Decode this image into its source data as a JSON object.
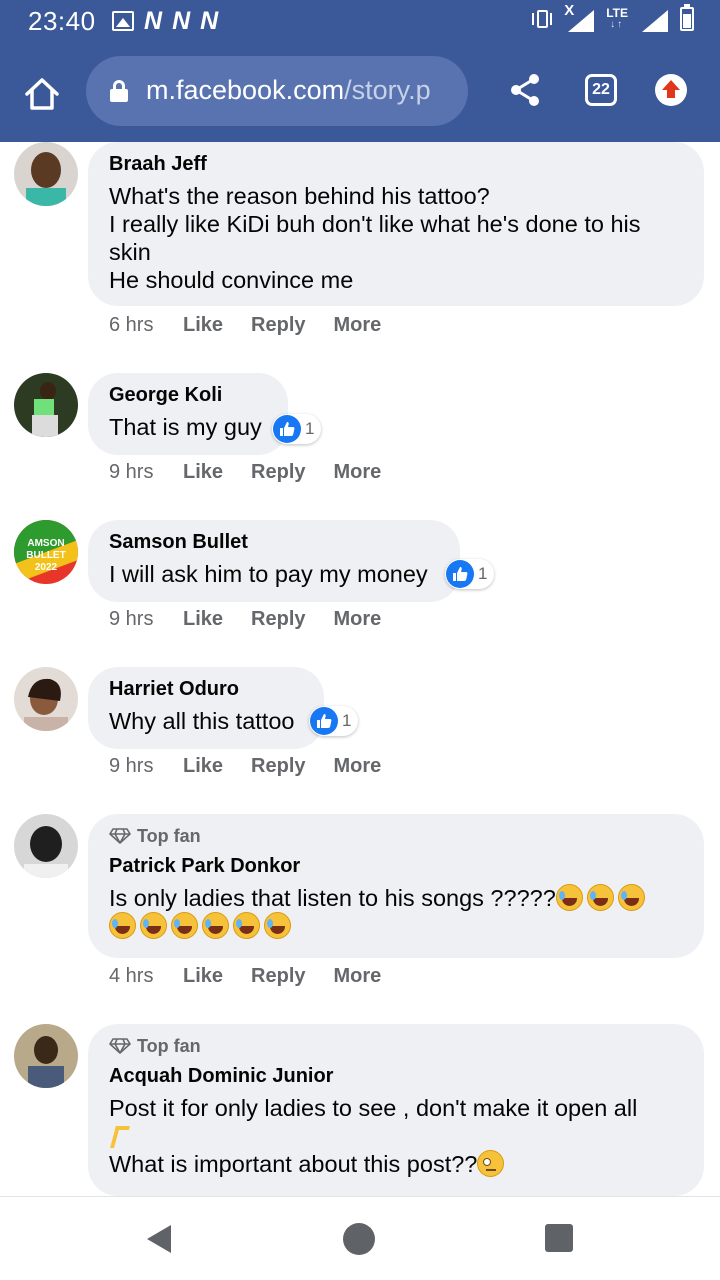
{
  "status_bar": {
    "time": "23:40",
    "notif_letters": [
      "N",
      "N",
      "N"
    ],
    "network": "LTE",
    "network_arrows": "↓↑",
    "signal_x": "X"
  },
  "browser": {
    "domain": "m.facebook.com",
    "path": "/story.p",
    "tab_count": "22"
  },
  "comments": [
    {
      "author": "Braah Jeff",
      "top_fan": false,
      "text": "What's the reason behind his tattoo?\nI really like KiDi buh don't like what he's done to his skin\nHe should convince me",
      "time": "6 hrs",
      "likes": null,
      "avatar_color": "#7d5a3c"
    },
    {
      "author": "George Koli",
      "top_fan": false,
      "text": "That is my guy",
      "time": "9 hrs",
      "likes": "1",
      "avatar_color": "#2d3b22"
    },
    {
      "author": "Samson Bullet",
      "top_fan": false,
      "text": "I will ask him to pay my money",
      "time": "9 hrs",
      "likes": "1",
      "avatar_color": "#2e8b2e",
      "avatar_text": "AMSON BULLET 2022"
    },
    {
      "author": "Harriet Oduro",
      "top_fan": false,
      "text": "Why all this tattoo",
      "time": "9 hrs",
      "likes": "1",
      "avatar_color": "#b89a8a"
    },
    {
      "author": "Patrick Park Donkor",
      "top_fan": true,
      "text": "Is only ladies that listen to his songs ?????",
      "time": "4 hrs",
      "likes": null,
      "avatar_color": "#8a8a8a"
    },
    {
      "author": "Acquah Dominic Junior",
      "top_fan": true,
      "text_line1": "Post it for only ladies to see , don't make it open all",
      "text_line2": "What is important about this post??",
      "time": null,
      "likes": null,
      "avatar_color": "#a08a6a"
    }
  ],
  "labels": {
    "top_fan": "Top fan",
    "like": "Like",
    "reply": "Reply",
    "more": "More"
  },
  "colors": {
    "brand_blue": "#3b5998",
    "like_blue": "#1877f2",
    "bubble_gray": "#eff0f3"
  }
}
